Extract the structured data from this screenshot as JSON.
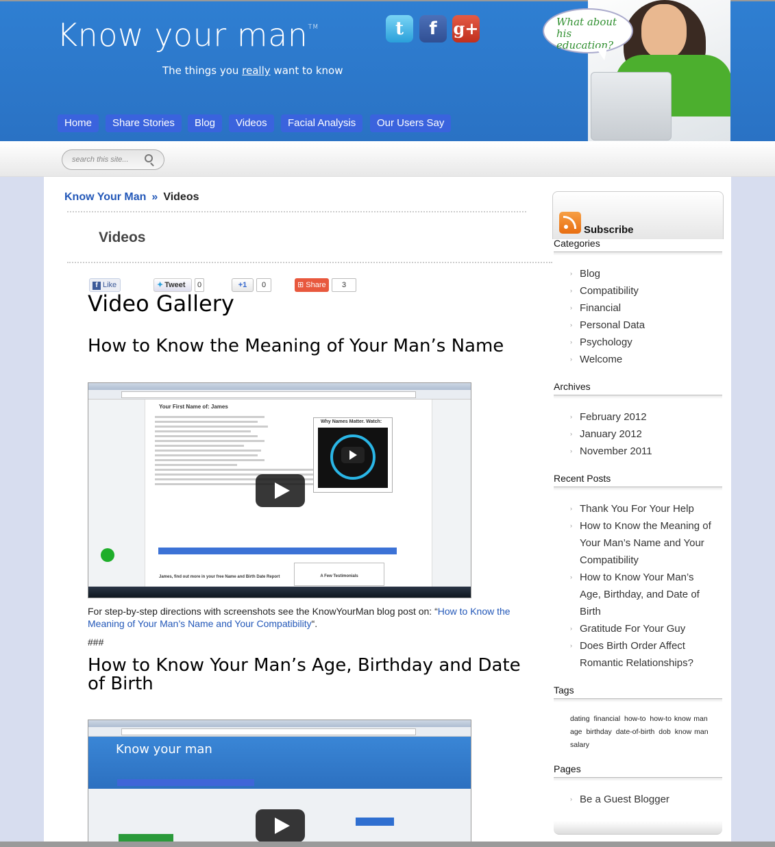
{
  "header": {
    "logo": "Know your man",
    "logo_tm": "TM",
    "tagline_pre": "The things you ",
    "tagline_em": "really",
    "tagline_post": " want to know",
    "bubble": "What about his education?",
    "social": [
      "twitter-icon",
      "facebook-icon",
      "google-plus-icon"
    ],
    "social_glyphs": {
      "twitter": "t",
      "facebook": "f",
      "googleplus": "g+"
    }
  },
  "nav": [
    "Home",
    "Share Stories",
    "Blog",
    "Videos",
    "Facial Analysis",
    "Our Users Say"
  ],
  "search": {
    "placeholder": "search this site..."
  },
  "breadcrumb": {
    "home": "Know Your Man",
    "sep": "»",
    "current": "Videos"
  },
  "page_title": "Videos",
  "share": {
    "like": "Like",
    "tweet": "Tweet",
    "tweet_count": "0",
    "plus": "+1",
    "plus_count": "0",
    "share": "Share",
    "share_count": "3"
  },
  "gallery_title": "Video Gallery",
  "videos": [
    {
      "title": "How to Know the Meaning of Your Man’s Name"
    },
    {
      "title": "How to Know Your Man’s Age, Birthday and Date of Birth"
    }
  ],
  "video1_screen": {
    "heading": "Your First Name of: James",
    "mini_title": "Why Names Matter. Watch:",
    "footer_text": "James, find out more in your free Name and Birth Date Report",
    "box_text": "A Few Testimonials"
  },
  "video2_screen": {
    "logo": "Know your man"
  },
  "caption": {
    "text": "For step-by-step directions with screenshots see the KnowYourMan blog post on: “",
    "link": "How to Know the Meaning of Your Man’s Name and Your Compatibility",
    "end": "“."
  },
  "hash": "###",
  "sidebar": {
    "subscribe": "Subscribe",
    "categories_title": "Categories",
    "categories": [
      "Blog",
      "Compatibility",
      "Financial",
      "Personal Data",
      "Psychology",
      "Welcome"
    ],
    "archives_title": "Archives",
    "archives": [
      "February 2012",
      "January 2012",
      "November 2011"
    ],
    "recent_title": "Recent Posts",
    "recent": [
      [
        "Thank You For Your Help"
      ],
      [
        "How to Know the Meaning of",
        "Your Man’s Name and Your",
        "Compatibility"
      ],
      [
        "How to Know Your Man’s",
        "Age, Birthday, and Date of",
        "Birth"
      ],
      [
        "Gratitude For Your Guy"
      ],
      [
        "Does Birth Order Affect",
        "Romantic Relationships?"
      ]
    ],
    "tags_title": "Tags",
    "tags": [
      "dating",
      "financial",
      "how-to",
      "how-to know man",
      "age",
      "birthday",
      "date-of-birth",
      "dob",
      "know man",
      "salary"
    ],
    "pages_title": "Pages",
    "pages": [
      "Be a Guest Blogger"
    ]
  }
}
